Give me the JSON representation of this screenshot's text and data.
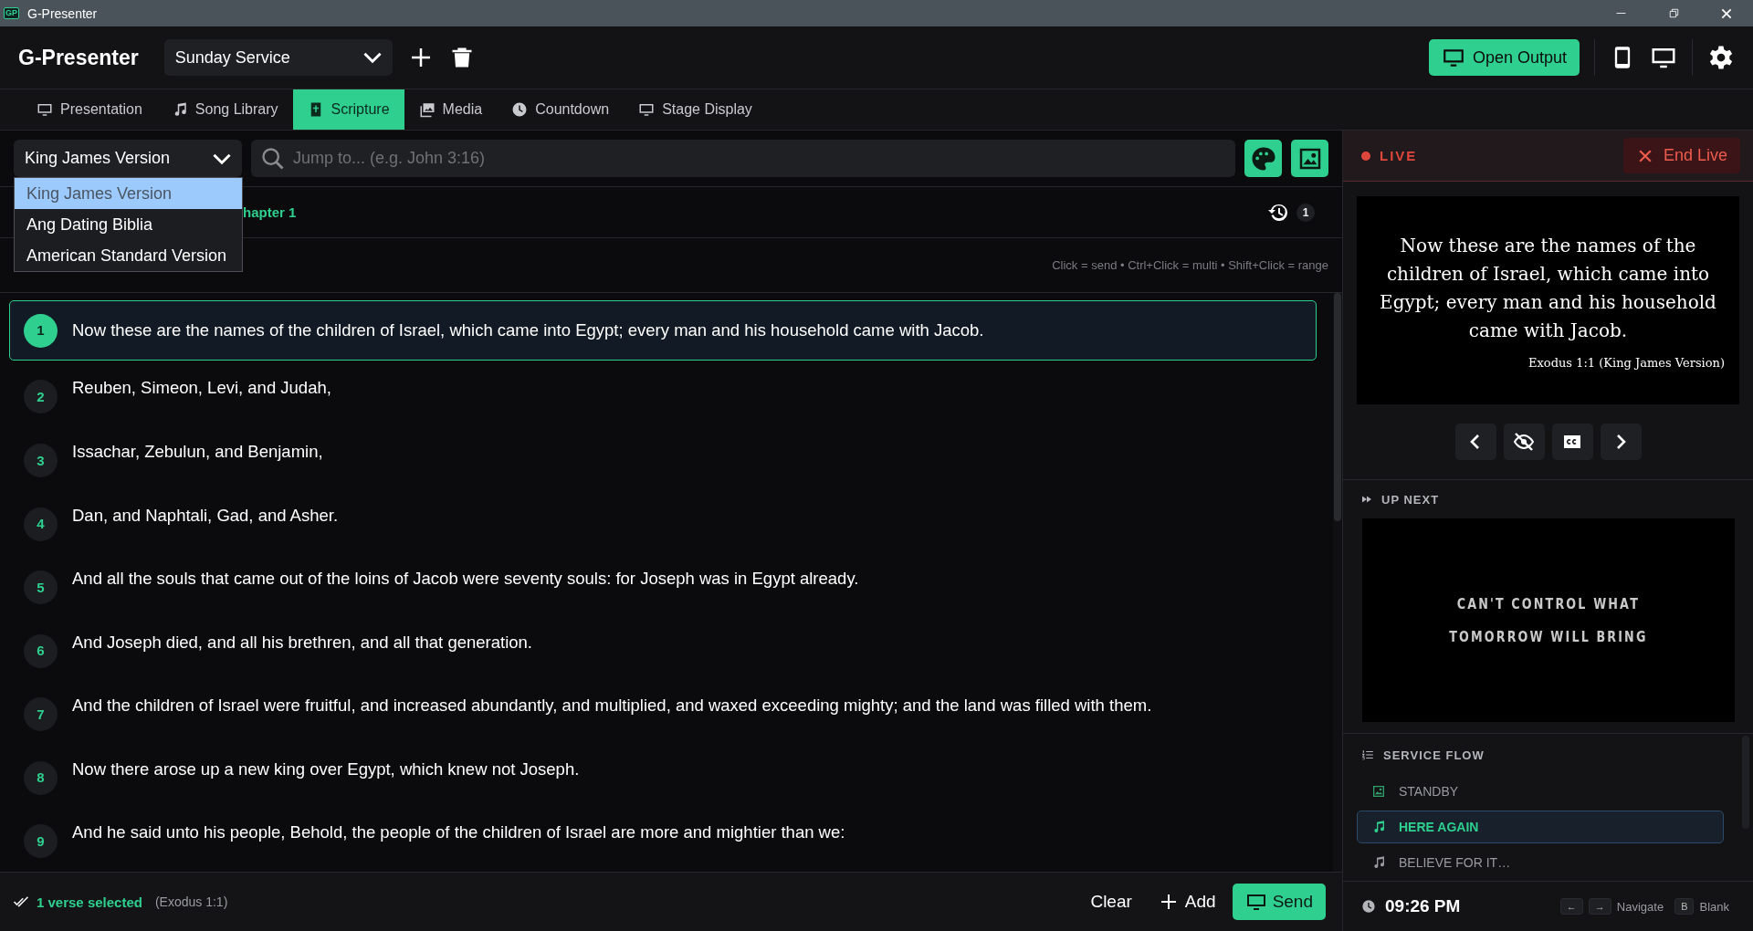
{
  "window": {
    "app_badge": "GP",
    "title": "G-Presenter"
  },
  "header": {
    "app_name": "G-Presenter",
    "service_select": "Sunday Service",
    "open_output": "Open Output"
  },
  "tabs": [
    {
      "label": "Presentation",
      "selected": false
    },
    {
      "label": "Song Library",
      "selected": false
    },
    {
      "label": "Scripture",
      "selected": true
    },
    {
      "label": "Media",
      "selected": false
    },
    {
      "label": "Countdown",
      "selected": false
    },
    {
      "label": "Stage Display",
      "selected": false
    }
  ],
  "scripture": {
    "version_select": "King James Version",
    "version_options": [
      {
        "label": "King James Version",
        "selected": true
      },
      {
        "label": "Ang Dating Biblia",
        "selected": false
      },
      {
        "label": "American Standard Version",
        "selected": false
      }
    ],
    "search": {
      "placeholder": "Jump to... (e.g. John 3:16)"
    },
    "breadcrumb": "hapter 1",
    "history_count": "1",
    "hint": "Click = send • Ctrl+Click = multi • Shift+Click = range",
    "verses": [
      {
        "number": "1",
        "text": "Now these are the names of the children of Israel, which came into Egypt; every man and his household came with Jacob.",
        "selected": true
      },
      {
        "number": "2",
        "text": "Reuben, Simeon, Levi, and Judah,",
        "selected": false
      },
      {
        "number": "3",
        "text": "Issachar, Zebulun, and Benjamin,",
        "selected": false
      },
      {
        "number": "4",
        "text": "Dan, and Naphtali, Gad, and Asher.",
        "selected": false
      },
      {
        "number": "5",
        "text": "And all the souls that came out of the loins of Jacob were seventy souls: for Joseph was in Egypt already.",
        "selected": false
      },
      {
        "number": "6",
        "text": "And Joseph died, and all his brethren, and all that generation.",
        "selected": false
      },
      {
        "number": "7",
        "text": "And the children of Israel were fruitful, and increased abundantly, and multiplied, and waxed exceeding mighty; and the land was filled with them.",
        "selected": false
      },
      {
        "number": "8",
        "text": "Now there arose up a new king over Egypt, which knew not Joseph.",
        "selected": false
      },
      {
        "number": "9",
        "text": "And he said unto his people, Behold, the people of the children of Israel are more and mightier than we:",
        "selected": false
      }
    ]
  },
  "selection_bar": {
    "status": "1 verse selected",
    "reference": "(Exodus 1:1)",
    "buttons": [
      "Clear",
      "Add",
      "Send"
    ]
  },
  "live": {
    "label": "LIVE",
    "end_button": "End Live",
    "preview_text": "Now these are the names of the children of Israel, which came into Egypt; every man and his household came with Jacob.",
    "preview_reference": "Exodus 1:1 (King James Version)"
  },
  "up_next": {
    "title": "UP NEXT",
    "lines": [
      "CAN'T CONTROL WHAT",
      "TOMORROW WILL BRING"
    ]
  },
  "service_flow": {
    "title": "SERVICE FLOW",
    "items": [
      {
        "label": "STANDBY",
        "kind": "media",
        "selected": false
      },
      {
        "label": "HERE AGAIN",
        "kind": "song",
        "selected": true
      },
      {
        "label": "BELIEVE FOR IT…",
        "kind": "song",
        "selected": false
      }
    ]
  },
  "footer": {
    "clock": "09:26 PM",
    "shortcuts": [
      {
        "keys": [
          "←",
          "→"
        ],
        "label": "Navigate"
      },
      {
        "keys": [
          "B"
        ],
        "label": "Blank"
      }
    ]
  }
}
